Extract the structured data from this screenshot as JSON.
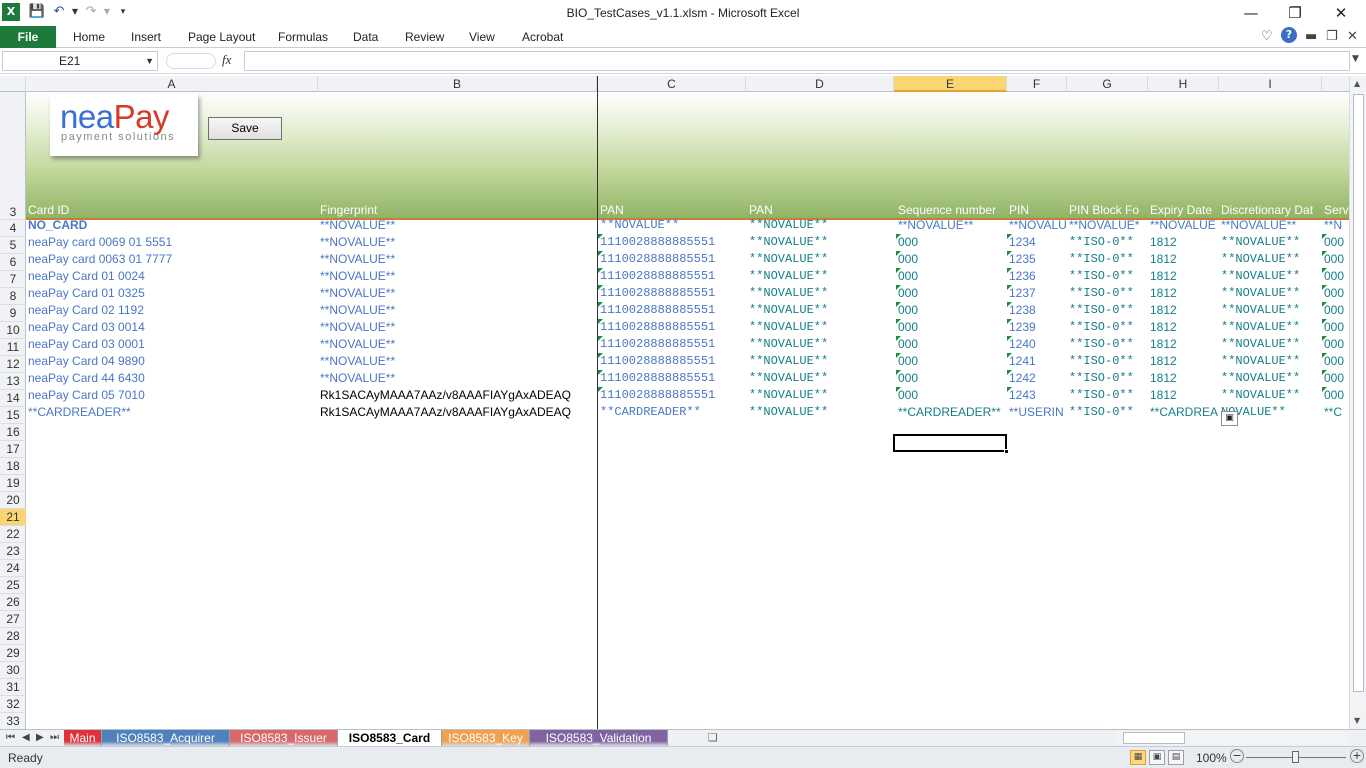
{
  "window": {
    "title": "BIO_TestCases_v1.1.xlsm  -  Microsoft Excel",
    "app_icon": "excel-icon",
    "controls": {
      "minimize": "—",
      "restore": "❐",
      "close": "✕"
    }
  },
  "quick_access": {
    "save": "save-icon",
    "undo": "undo-icon",
    "redo": "redo-icon",
    "customize": "customize-icon"
  },
  "ribbon": {
    "file": "File",
    "tabs": [
      "Home",
      "Insert",
      "Page Layout",
      "Formulas",
      "Data",
      "Review",
      "View",
      "Acrobat"
    ]
  },
  "formula_bar": {
    "name_box": "E21",
    "fx": "fx",
    "content": ""
  },
  "columns": [
    "A",
    "B",
    "C",
    "D",
    "E",
    "F",
    "G",
    "H",
    "I",
    "J"
  ],
  "selected_column": "E",
  "rows": [
    "3",
    "4",
    "5",
    "6",
    "7",
    "8",
    "9",
    "10",
    "11",
    "12",
    "13",
    "14",
    "15",
    "16",
    "17",
    "18",
    "19",
    "20",
    "21",
    "22",
    "23",
    "24",
    "25",
    "26",
    "27",
    "28",
    "29",
    "30",
    "31",
    "32",
    "33"
  ],
  "selected_row": "21",
  "banner": {
    "logo_brand_1": "nea",
    "logo_brand_2": "Pay",
    "logo_tagline": "payment solutions",
    "save_button": "Save"
  },
  "headers": [
    "Card ID",
    "Fingerprint",
    "PAN",
    "PAN",
    "Sequence number",
    "PIN",
    "PIN Block Fo",
    "Expiry Date",
    "Discretionary Dat",
    "Serv"
  ],
  "data_rows": [
    [
      "NO_CARD",
      "**NOVALUE**",
      "**NOVALUE**",
      "**NOVALUE**",
      "**NOVALUE**",
      "**NOVALU",
      "**NOVALUE*",
      "**NOVALUE",
      "**NOVALUE**",
      "**N"
    ],
    [
      "neaPay card 0069 01 5551",
      "**NOVALUE**",
      "1110028888885551",
      "**NOVALUE**",
      "000",
      "1234",
      "**ISO-0**",
      "1812",
      "**NOVALUE**",
      "000"
    ],
    [
      "neaPay card 0063 01 7777",
      "**NOVALUE**",
      "1110028888885551",
      "**NOVALUE**",
      "000",
      "1235",
      "**ISO-0**",
      "1812",
      "**NOVALUE**",
      "000"
    ],
    [
      "neaPay Card 01 0024",
      "**NOVALUE**",
      "1110028888885551",
      "**NOVALUE**",
      "000",
      "1236",
      "**ISO-0**",
      "1812",
      "**NOVALUE**",
      "000"
    ],
    [
      "neaPay Card 01 0325",
      "**NOVALUE**",
      "1110028888885551",
      "**NOVALUE**",
      "000",
      "1237",
      "**ISO-0**",
      "1812",
      "**NOVALUE**",
      "000"
    ],
    [
      "neaPay Card 02 1192",
      "**NOVALUE**",
      "1110028888885551",
      "**NOVALUE**",
      "000",
      "1238",
      "**ISO-0**",
      "1812",
      "**NOVALUE**",
      "000"
    ],
    [
      "neaPay Card 03 0014",
      "**NOVALUE**",
      "1110028888885551",
      "**NOVALUE**",
      "000",
      "1239",
      "**ISO-0**",
      "1812",
      "**NOVALUE**",
      "000"
    ],
    [
      "neaPay Card 03 0001",
      "**NOVALUE**",
      "1110028888885551",
      "**NOVALUE**",
      "000",
      "1240",
      "**ISO-0**",
      "1812",
      "**NOVALUE**",
      "000"
    ],
    [
      "neaPay Card 04 9890",
      "**NOVALUE**",
      "1110028888885551",
      "**NOVALUE**",
      "000",
      "1241",
      "**ISO-0**",
      "1812",
      "**NOVALUE**",
      "000"
    ],
    [
      "neaPay Card 44 6430",
      "**NOVALUE**",
      "1110028888885551",
      "**NOVALUE**",
      "000",
      "1242",
      "**ISO-0**",
      "1812",
      "**NOVALUE**",
      "000"
    ],
    [
      "neaPay Card 05 7010",
      "Rk1SACAyMAAA7AAz/v8AAAFIAYgAxADEAQ",
      "1110028888885551",
      "**NOVALUE**",
      "000",
      "1243",
      "**ISO-0**",
      "1812",
      "**NOVALUE**",
      "000"
    ],
    [
      "**CARDREADER**",
      "Rk1SACAyMAAA7AAz/v8AAAFIAYgAxADEAQ",
      "**CARDREADER**",
      "**NOVALUE**",
      "**CARDREADER**",
      "**USERIN",
      "**ISO-0**",
      "**CARDREA",
      "NOVALUE**",
      "**C"
    ]
  ],
  "sheet_tabs": [
    {
      "label": "Main",
      "color": "#e0303a"
    },
    {
      "label": "ISO8583_Acquirer",
      "color": "#4f81bd"
    },
    {
      "label": "ISO8583_Issuer",
      "color": "#d9686a"
    },
    {
      "label": "ISO8583_Card",
      "color": "#ffffff",
      "active": true
    },
    {
      "label": "ISO8583_Key",
      "color": "#f0a050"
    },
    {
      "label": "ISO8583_Validation",
      "color": "#8064a2"
    }
  ],
  "status": {
    "ready": "Ready",
    "zoom": "100%"
  }
}
